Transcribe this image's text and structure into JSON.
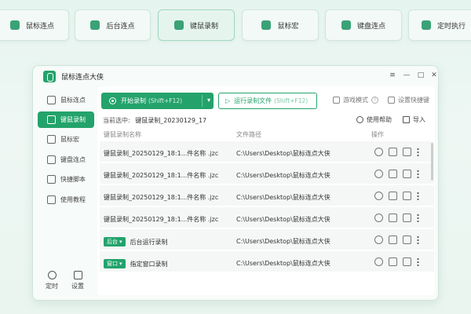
{
  "feature_tabs": [
    {
      "label": "鼠标连点",
      "icon": "mouse-click-icon"
    },
    {
      "label": "后台连点",
      "icon": "monitor-icon"
    },
    {
      "label": "键鼠录制",
      "icon": "camera-icon",
      "active": true
    },
    {
      "label": "鼠标宏",
      "icon": "mouse-icon"
    },
    {
      "label": "键盘连点",
      "icon": "keyboard-icon"
    },
    {
      "label": "定时执行",
      "icon": "clock-icon"
    }
  ],
  "app": {
    "title": "鼠标连点大侠",
    "accent": "#23a36b"
  },
  "window_controls": [
    "≡",
    "—",
    "□",
    "✕"
  ],
  "sidebar": {
    "items": [
      {
        "label": "鼠标连点",
        "icon": "mouse-click-icon"
      },
      {
        "label": "键鼠录制",
        "icon": "record-icon",
        "active": true
      },
      {
        "label": "鼠标宏",
        "icon": "mouse-icon"
      },
      {
        "label": "键盘连点",
        "icon": "keyboard-icon"
      },
      {
        "label": "快捷脚本",
        "icon": "script-icon"
      },
      {
        "label": "使用教程",
        "icon": "book-icon"
      }
    ],
    "bottom": [
      {
        "label": "定时",
        "icon": "timer-icon"
      },
      {
        "label": "设置",
        "icon": "settings-icon"
      }
    ]
  },
  "toolbar": {
    "start_label": "开始录制",
    "start_shortcut": "(Shift+F12)",
    "run_label": "运行录制文件",
    "run_shortcut": "(Shift+F12)",
    "game_mode": "游戏模式",
    "set_hotkey": "设置快捷键"
  },
  "selection": {
    "prefix": "当前选中:",
    "value": "键鼠录制_20230129_17"
  },
  "actions": {
    "help": "使用帮助",
    "import": "导入"
  },
  "table": {
    "headers": {
      "name": "键鼠录制名称",
      "path": "文件路径",
      "ops": "操作"
    },
    "rows": [
      {
        "name": "键鼠录制_20250129_18:1...件名称 .jzc",
        "path": "C:\\Users\\Desktop\\鼠标连点大侠"
      },
      {
        "name": "键鼠录制_20250129_18:1...件名称 .jzc",
        "path": "C:\\Users\\Desktop\\鼠标连点大侠"
      },
      {
        "name": "键鼠录制_20250129_18:1...件名称 .jzc",
        "path": "C:\\Users\\Desktop\\鼠标连点大侠"
      },
      {
        "name": "键鼠录制_20250129_18:1...件名称 .jzc",
        "path": "C:\\Users\\Desktop\\鼠标连点大侠"
      },
      {
        "badge": "后台",
        "name": "后台运行录制",
        "path": "C:\\Users\\Desktop\\鼠标连点大侠"
      },
      {
        "badge": "窗口",
        "name": "指定窗口录制",
        "path": "C:\\Users\\Desktop\\鼠标连点大侠"
      }
    ]
  }
}
